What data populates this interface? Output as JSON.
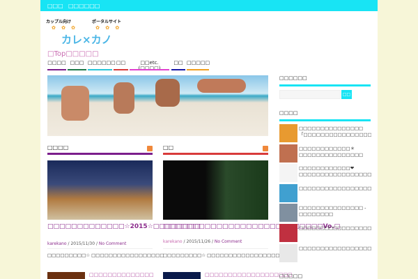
{
  "topbar": {
    "items": [
      "□□□",
      "□□□□□□"
    ]
  },
  "logo": {
    "tagline_left": "カップル向け",
    "tagline_right": "ポータルサイト",
    "name": "カレ×カノ"
  },
  "site_title": "□Top□□□□□",
  "nav": [
    {
      "label": "□□□□",
      "color": "#7b1e8c"
    },
    {
      "label": "□□□",
      "color": "#1e7a4a"
    },
    {
      "label": "□□□□□□",
      "color": "#2ac6d8"
    },
    {
      "label": "□□",
      "color": "#d83a3a"
    },
    {
      "label": "□□etc.(□□□□)",
      "color": "#e040d0"
    },
    {
      "label": "□□",
      "color": "#1a1aa8"
    },
    {
      "label": "□□□□□",
      "color": "#f0a020"
    }
  ],
  "sections": [
    {
      "title": "□□□□",
      "color": "#7b1e8c",
      "post": {
        "title": "□□□□□□□□□□□□□☆2015☆□□□□□□□□",
        "author": "karekano",
        "date": "2015/11/30",
        "comments": "No Comment",
        "excerpt": "□□□□□□□□□☆ □□□□□□□□□□□□□□□□□"
      },
      "next": "□□□□□□□□□□□□□□"
    },
    {
      "title": "□□",
      "color": "#d83a3a",
      "post": {
        "title": "□□□□□□□□□□□□□□□□□□□□□□□□□□□Vo.□",
        "author": "karekano",
        "date": "2015/11/26",
        "comments": "No Comment",
        "excerpt": "□□□□□□□□□☆ □□□□□□□□□□□□□□□□□"
      },
      "next": "□□□□□□□□□□□□□□□□□□□"
    }
  ],
  "sidebar": {
    "search_title": "□□□□□□",
    "search_button": "□□",
    "search_placeholder": "",
    "recent_title": "□□□□",
    "recent": [
      "□□□□□□□□□□□□□□□「□□□□□□□□□□□□□□□□□",
      "□□□□□□□□□□□□＊□□□□□□□□□□□□□□□",
      "□□□□□□□□□□□□❤□□□□□□□□□□□□□□□□□□□□□",
      "□□□□□□□□□□□□□□□□□□□□□□□□□□□□□□□",
      "□□□□□□□□□□□□□□□ - □□□□□□□□",
      "□□□□□□□□□□□□□□□□□□□□□□□□□□□□",
      "□□□□□□□□□□□□□□□□□□□□□□□□□□"
    ],
    "next_title": "□□□□□"
  }
}
